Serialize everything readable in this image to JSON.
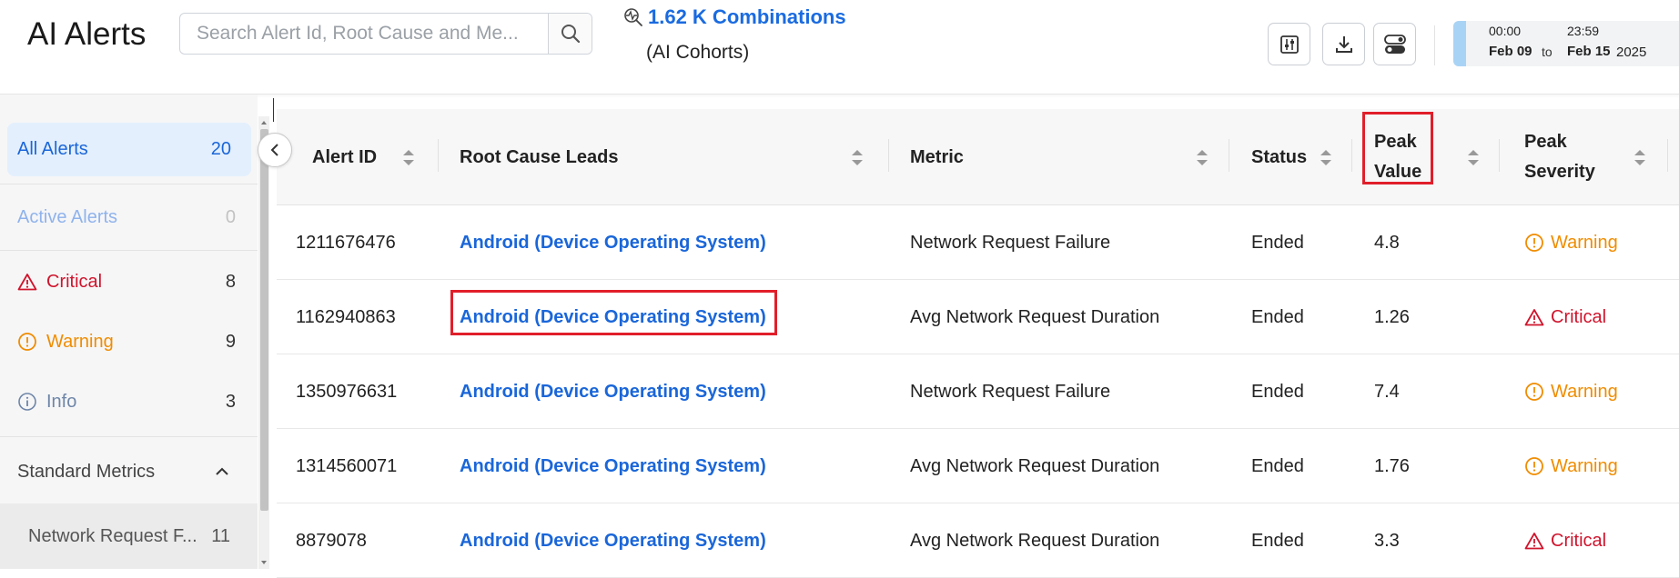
{
  "header": {
    "title": "AI Alerts",
    "search_placeholder": "Search Alert Id, Root Cause and Me...",
    "combinations_link": "1.62 K Combinations",
    "combinations_sub": "(AI Cohorts)"
  },
  "date_range": {
    "start_time": "00:00",
    "start_day": "Feb 09",
    "to": "to",
    "end_time": "23:59",
    "end_day": "Feb 15",
    "year": "2025"
  },
  "sidebar": {
    "all": {
      "label": "All Alerts",
      "count": "20"
    },
    "active": {
      "label": "Active Alerts",
      "count": "0"
    },
    "critical": {
      "label": "Critical",
      "count": "8"
    },
    "warning": {
      "label": "Warning",
      "count": "9"
    },
    "info": {
      "label": "Info",
      "count": "3"
    },
    "section": {
      "label": "Standard Metrics"
    },
    "sub_item": {
      "label": "Network Request F...",
      "count": "11"
    }
  },
  "table": {
    "columns": {
      "alert_id": "Alert ID",
      "root_cause": "Root Cause Leads",
      "metric": "Metric",
      "status": "Status",
      "peak_value_1": "Peak",
      "peak_value_2": "Value",
      "peak_severity_1": "Peak",
      "peak_severity_2": "Severity"
    },
    "rows": [
      {
        "id": "1211676476",
        "root_cause": "Android (Device Operating System)",
        "metric": "Network Request Failure",
        "status": "Ended",
        "peak": "4.8",
        "severity": "Warning"
      },
      {
        "id": "1162940863",
        "root_cause": "Android (Device Operating System)",
        "metric": "Avg Network Request Duration",
        "status": "Ended",
        "peak": "1.26",
        "severity": "Critical"
      },
      {
        "id": "1350976631",
        "root_cause": "Android (Device Operating System)",
        "metric": "Network Request Failure",
        "status": "Ended",
        "peak": "7.4",
        "severity": "Warning"
      },
      {
        "id": "1314560071",
        "root_cause": "Android (Device Operating System)",
        "metric": "Avg Network Request Duration",
        "status": "Ended",
        "peak": "1.76",
        "severity": "Warning"
      },
      {
        "id": "8879078",
        "root_cause": "Android (Device Operating System)",
        "metric": "Avg Network Request Duration",
        "status": "Ended",
        "peak": "3.3",
        "severity": "Critical"
      }
    ]
  },
  "colors": {
    "accent": "#1a66d9",
    "warning": "#f08c00",
    "critical": "#d0142c",
    "highlight": "#e11e2a"
  }
}
